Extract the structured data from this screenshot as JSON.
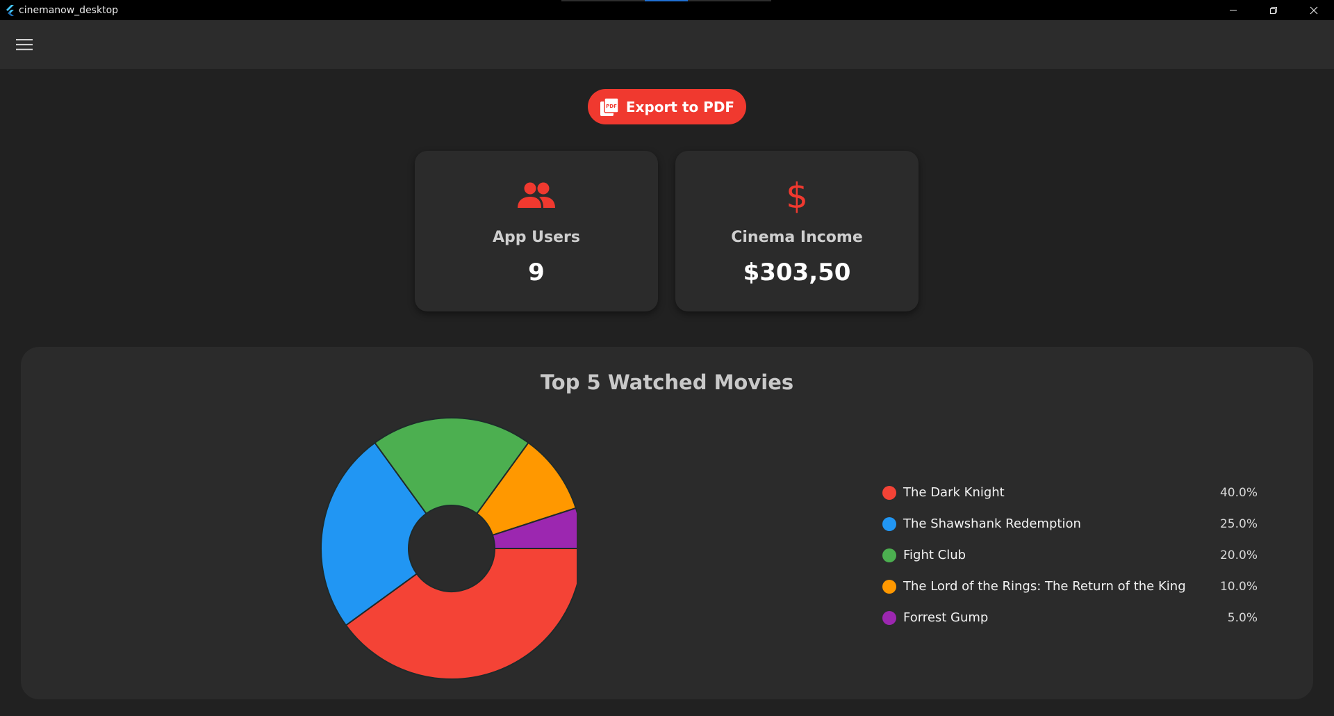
{
  "window": {
    "title": "cinemanow_desktop"
  },
  "header": {
    "menu_icon": "hamburger-menu-icon"
  },
  "actions": {
    "export_label": "Export to PDF",
    "export_icon": "pdf-icon"
  },
  "stats": {
    "users": {
      "label": "App Users",
      "value": "9",
      "icon": "people-icon"
    },
    "income": {
      "label": "Cinema Income",
      "value": "$303,50",
      "icon": "dollar-icon"
    }
  },
  "colors": {
    "accent": "#f0392f",
    "background": "#212121",
    "card": "#2b2b2b"
  },
  "chart_data": {
    "type": "pie",
    "title": "Top 5 Watched Movies",
    "donut": true,
    "legend_position": "right",
    "labels": [
      "The Dark Knight",
      "The Shawshank Redemption",
      "Fight Club",
      "The Lord of the Rings: The Return of the King",
      "Forrest Gump"
    ],
    "values": [
      40.0,
      25.0,
      20.0,
      10.0,
      5.0
    ],
    "value_labels": [
      "40.0%",
      "25.0%",
      "20.0%",
      "10.0%",
      "5.0%"
    ],
    "colors": [
      "#f44336",
      "#2196f3",
      "#4caf50",
      "#ff9800",
      "#9c27b0"
    ]
  }
}
